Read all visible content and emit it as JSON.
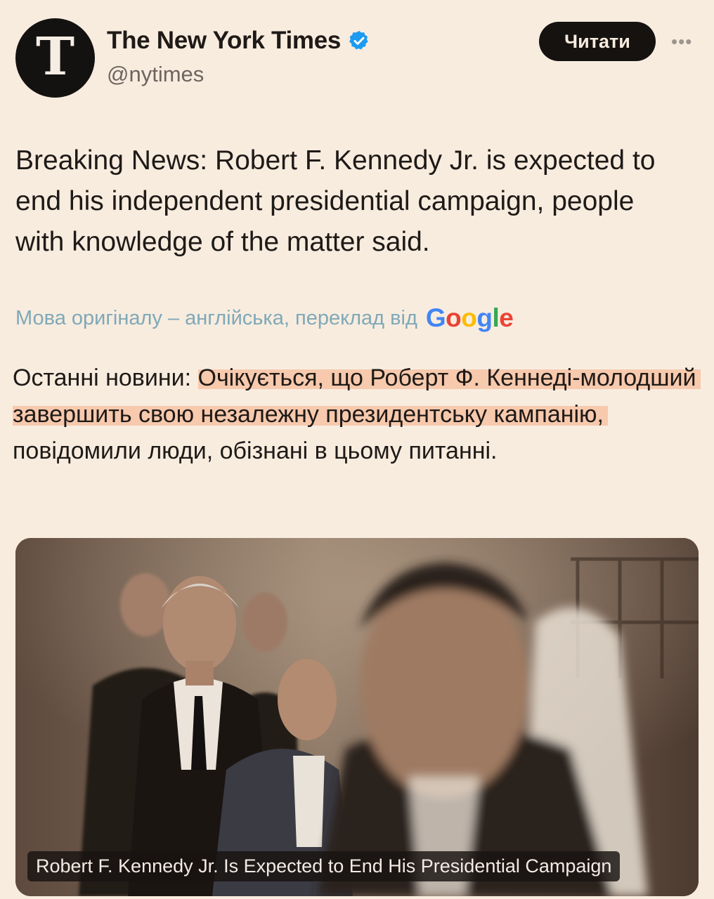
{
  "account": {
    "name": "The New York Times",
    "handle": "@nytimes",
    "avatar_glyph": "T",
    "verified_icon": "verified-badge-icon",
    "verified_color": "#1d9bf0"
  },
  "follow_label": "Читати",
  "more_icon": "more-options-icon",
  "tweet_text": "Breaking News: Robert F. Kennedy Jr. is expected to end his independent presidential campaign, people with knowledge of the matter said.",
  "translation": {
    "label": "Мова оригіналу – англійська, переклад від",
    "provider": "Google",
    "text_prefix": "Останні новини: ",
    "text_highlighted": "Очікується, що Роберт Ф. Кеннеді-молодший завершить свою незалежну президентську кампанію,",
    "text_rest": " повідомили люди, обізнані в цьому питанні.",
    "highlight_color": "#f7c9ad"
  },
  "media": {
    "caption": "Robert F. Kennedy Jr. Is Expected to End His Presidential Campaign"
  },
  "colors": {
    "background": "#f8ecdf",
    "button": "#151210",
    "translate_link": "#7fa9b7"
  }
}
